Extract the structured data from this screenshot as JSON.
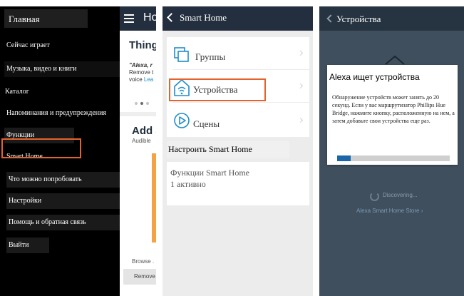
{
  "menu_panel": {
    "title": "Главная",
    "items": [
      {
        "label": "Сейчас играет"
      },
      {
        "label": "Музыка, видео и книги"
      },
      {
        "label": "Каталог"
      },
      {
        "label": "Напоминания и предупреждения"
      },
      {
        "label": "Функции"
      },
      {
        "label": "Smart Home",
        "highlighted": true
      },
      {
        "label": "Что можно попробовать"
      },
      {
        "label": "Настройки"
      },
      {
        "label": "Помощь и обратная связь"
      },
      {
        "label": "Выйти"
      }
    ],
    "background_app": {
      "header_title": "Ho",
      "card_title": "Thing",
      "quote_line1": "\"Alexa, r",
      "quote_line2": "Remove t",
      "quote_line3_text": "voice ",
      "quote_line3_link": "Lea",
      "add_title": "Add a",
      "add_subtitle": "Audible",
      "browse": "Browse .",
      "remove_button": "Remove"
    }
  },
  "smart_home_panel": {
    "header_title": "Smart Home",
    "rows": [
      {
        "label": "Группы",
        "icon": "groups-icon"
      },
      {
        "label": "Устройства",
        "icon": "devices-icon",
        "highlighted": true
      },
      {
        "label": "Сцены",
        "icon": "scenes-icon"
      }
    ],
    "section_header": "Настроить Smart Home",
    "functions_title": "Функции Smart Home",
    "functions_status": "1 активно"
  },
  "devices_panel": {
    "header_title": "Устройства",
    "dialog": {
      "title": "Alexa ищет устройства",
      "text": "Обнаружение устройств может занять до 20 секунд. Если у вас маршрутизатор Phillips Hue Bridge, нажмите кнопку, расположенную на нем, а затем добавьте свои устройства еще раз.",
      "progress": 0.12
    },
    "status": "Discovering...",
    "store_link": "Alexa Smart Home Store"
  },
  "colors": {
    "highlight": "#e4632d",
    "app_header": "#232f3e",
    "progress_fill": "#1a66a8",
    "accent_orange": "#f3a244"
  }
}
